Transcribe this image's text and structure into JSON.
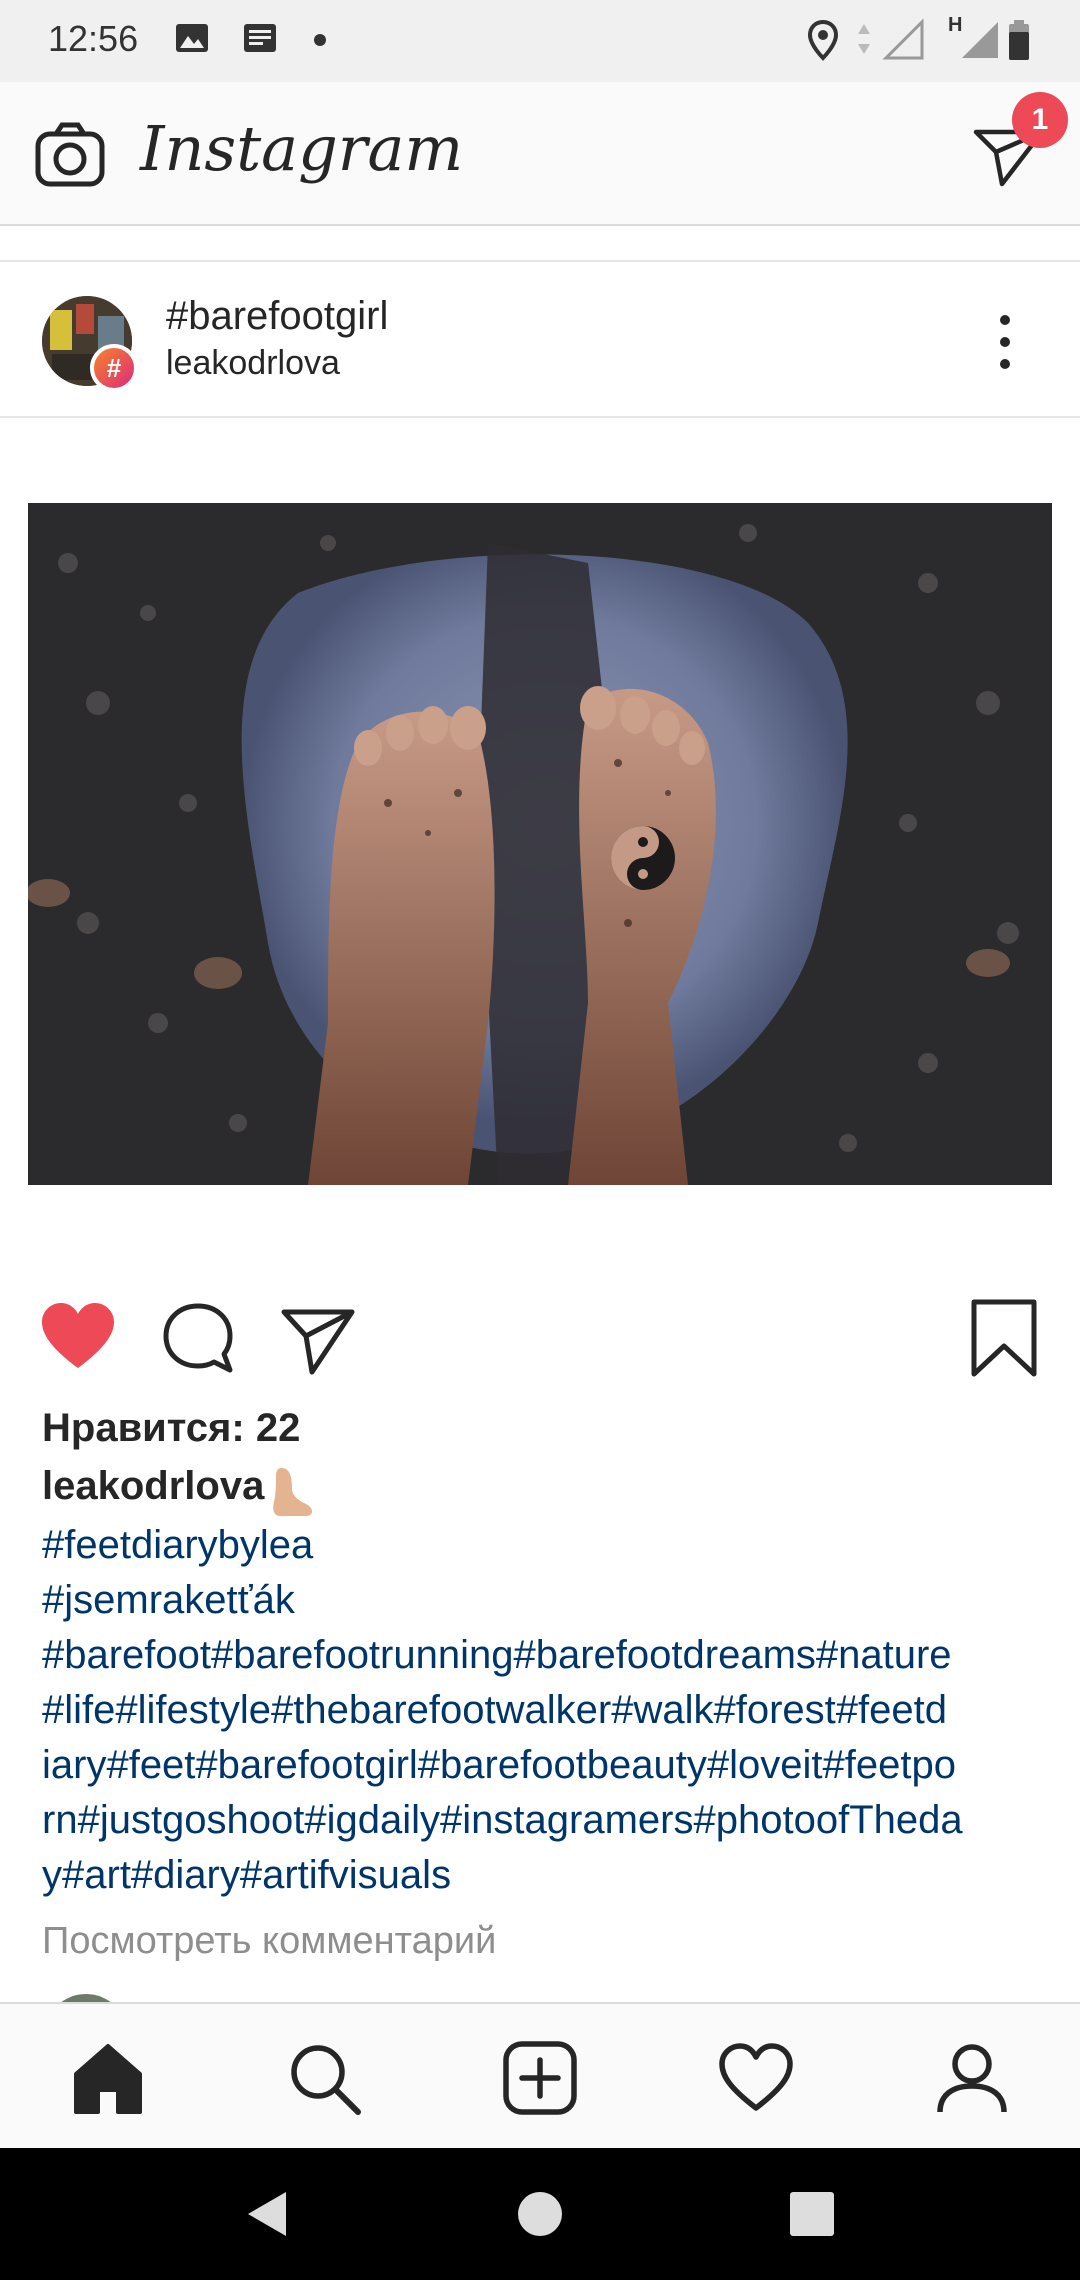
{
  "status_bar": {
    "time": "12:56",
    "icons_left": [
      "image-icon",
      "news-icon",
      "dot-icon"
    ],
    "icons_right": [
      "location-icon",
      "signal-icon",
      "battery-icon"
    ],
    "network_label": "H"
  },
  "header": {
    "logo_text": "Instagram",
    "direct_badge_count": "1"
  },
  "post": {
    "title": "#barefootgirl",
    "username": "leakodrlova",
    "hash_badge": "#",
    "likes_text": "Нравится: 22",
    "caption_user": "leakodrlova",
    "caption_tags": [
      "#feetdiarybylea",
      "#jsemraketťák",
      "#barefoot#barefootrunning#barefootdreams#nature",
      "#life#lifestyle#thebarefootwalker#walk#forest#feetd",
      "iary#feet#barefootgirl#barefootbeauty#loveit#feetpo",
      "rn#justgoshoot#igdaily#instagramers#photoofTheda",
      "y#art#diary#artifvisuals"
    ],
    "view_comments": "Посмотреть комментарий",
    "liked": true
  },
  "colors": {
    "like_red": "#ed4956",
    "hashtag_blue": "#003569",
    "muted_gray": "#8e8e8e"
  }
}
